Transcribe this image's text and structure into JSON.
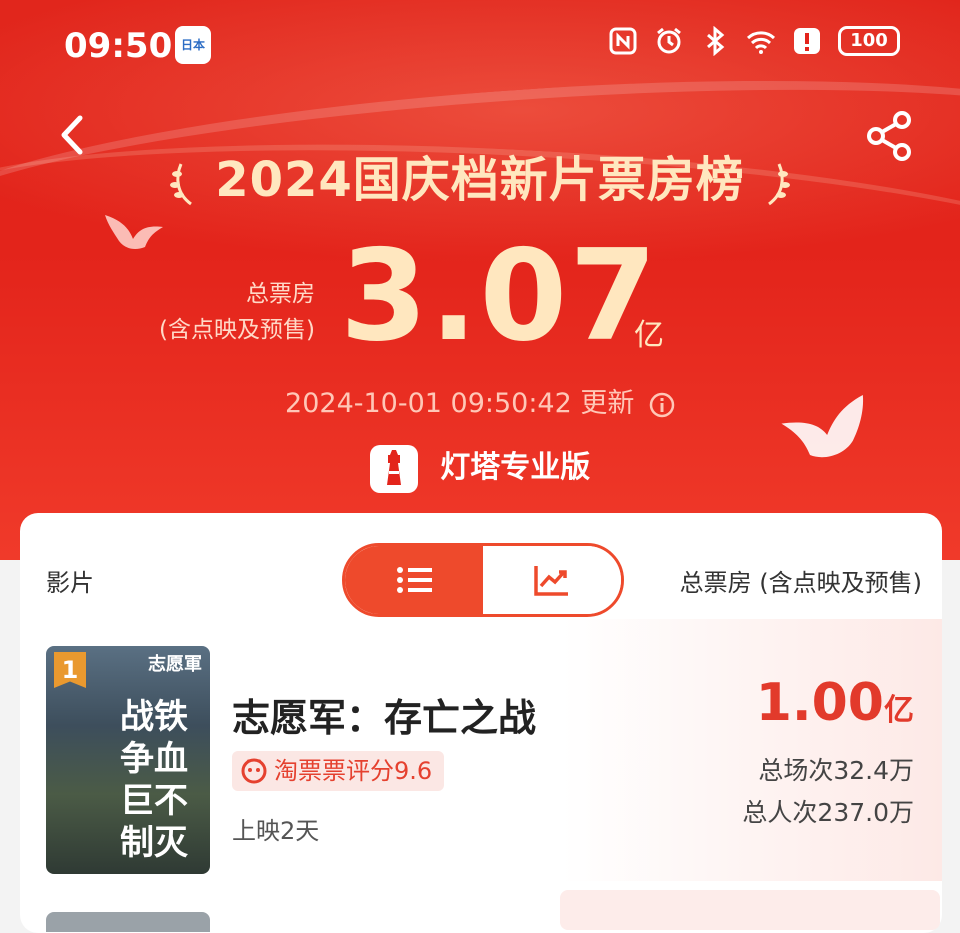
{
  "status_bar": {
    "time": "09:50",
    "app_badge": "日本",
    "battery": "100"
  },
  "header": {
    "title": "2024国庆档新片票房榜",
    "total_label_line1": "总票房",
    "total_label_line2": "(含点映及预售)",
    "total_value": "3.07",
    "total_unit": "亿",
    "updated": "2024-10-01 09:50:42 更新",
    "brand": "灯塔专业版"
  },
  "table": {
    "col_film": "影片",
    "col_box_office": "总票房 (含点映及预售)",
    "views": [
      "list-view",
      "trend-view"
    ],
    "active_view": "list-view"
  },
  "films": [
    {
      "rank": "1",
      "poster_brand": "志愿軍",
      "poster_text": "战铁争血巨不制灭",
      "title": "志愿军：存亡之战",
      "rating": "淘票票评分9.6",
      "days": "上映2天",
      "gross": "1.00",
      "gross_unit": "亿",
      "sessions": "总场次32.4万",
      "people": "总人次237.0万"
    }
  ],
  "colors": {
    "accent": "#e23a2b",
    "hero": "#e3241b",
    "title_gold": "#ffe7bf"
  }
}
